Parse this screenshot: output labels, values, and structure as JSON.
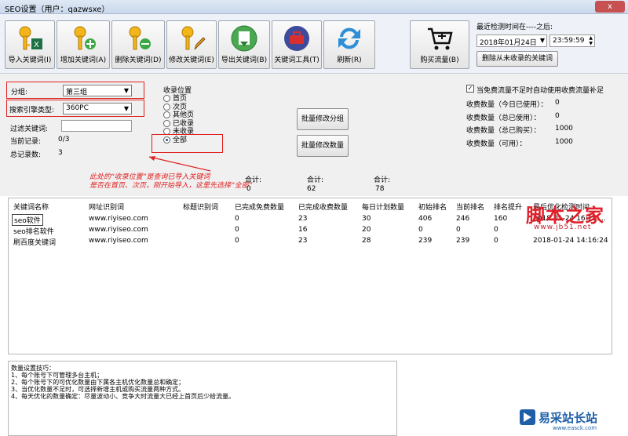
{
  "window": {
    "title": "SEO设置（用户：qazwsxe）",
    "close_glyph": "x"
  },
  "toolbar": {
    "buttons": [
      {
        "label": "导入关键词(I)",
        "icon": "key-excel-icon"
      },
      {
        "label": "增加关键词(A)",
        "icon": "key-add-icon"
      },
      {
        "label": "删除关键词(D)",
        "icon": "key-remove-icon"
      },
      {
        "label": "修改关键词(E)",
        "icon": "key-edit-icon"
      },
      {
        "label": "导出关键词(B)",
        "icon": "export-icon"
      },
      {
        "label": "关键词工具(T)",
        "icon": "toolbox-icon"
      },
      {
        "label": "刷新(R)",
        "icon": "refresh-icon"
      },
      {
        "label": "购买流量(B)",
        "icon": "cart-icon"
      }
    ],
    "last_check_label": "最近检测时间在----之后:",
    "date_value": "2018年01月24日",
    "time_value": "23:59:59",
    "delete_unindexed_label": "删除从未收录的关键词"
  },
  "filters": {
    "group_label": "分组:",
    "group_value": "第三组",
    "engine_label": "搜索引擎类型:",
    "engine_value": "360PC",
    "filter_keyword_label": "过滤关键词:",
    "current_records_label": "当前记录:",
    "current_records_value": "0/3",
    "total_records_label": "总记录数:",
    "total_records_value": "3",
    "index_position_label": "收录位置",
    "index_options": [
      "首页",
      "次页",
      "其他页",
      "已收录",
      "未收录",
      "全部"
    ],
    "index_selected": "全部",
    "batch_group_label": "批量修改分组",
    "batch_count_label": "批量修改数量"
  },
  "paid": {
    "auto_label": "当免费流量不足时自动使用收费流量补足",
    "rows": [
      {
        "label": "收费数量（今日已使用）：",
        "value": "0"
      },
      {
        "label": "收费数量（总已使用）：",
        "value": "0"
      },
      {
        "label": "收费数量（总已购买）：",
        "value": "1000"
      },
      {
        "label": "收费数量（可用）：",
        "value": "1000"
      }
    ]
  },
  "annotation": {
    "line1": "此处的“收录位置”是查询已导入关键词",
    "line2": "是否在首页、次页，刚开始导入，这里先选择“全部”"
  },
  "totals": [
    {
      "label": "合计:",
      "value": "0"
    },
    {
      "label": "合计:",
      "value": "62"
    },
    {
      "label": "合计:",
      "value": "78"
    }
  ],
  "table": {
    "headers": [
      "关键词名称",
      "网址识别词",
      "标题识别词",
      "已完成免费数量",
      "已完成收费数量",
      "每日计划数量",
      "初始排名",
      "当前排名",
      "排名提升",
      "最后优化检测时间"
    ],
    "rows": [
      [
        "seo软件",
        "www.riyiseo.com",
        "",
        "0",
        "23",
        "30",
        "406",
        "246",
        "160",
        "2018-01-24 16:15:..."
      ],
      [
        "seo排名软件",
        "www.riyiseo.com",
        "",
        "0",
        "16",
        "20",
        "0",
        "0",
        "0",
        ""
      ],
      [
        "刷百度关键词",
        "www.riyiseo.com",
        "",
        "0",
        "23",
        "28",
        "239",
        "239",
        "0",
        "2018-01-24 14:16:24"
      ]
    ]
  },
  "tips": {
    "title": "数量设置技巧：",
    "lines": [
      "1、每个账号下可管理多台主机；",
      "2、每个账号下的可优化数量由下属各主机优化数量总和确定；",
      "3、当优化数量不足时，可选择新增主机或购买流量两种方式。",
      "4、每天优化的数量确定：尽量波动小、竞争大时流量大已经上首页后少给流量。"
    ]
  },
  "watermarks": {
    "site_name": "脚本之家",
    "site_url": "www.jb51.net",
    "brand": "易采站长站",
    "brand_url": "www.easck.com"
  },
  "colors": {
    "annotation_red": "#e02020",
    "toolbar_bg": "#eef2f8",
    "panel_bg": "#f0f0f0"
  }
}
